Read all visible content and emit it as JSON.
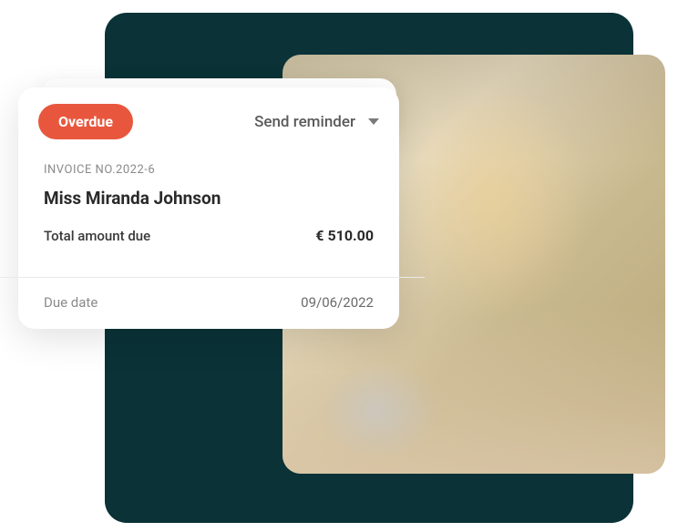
{
  "invoice": {
    "status_label": "Overdue",
    "action_label": "Send reminder",
    "invoice_no_label": "INVOICE NO.2022-6",
    "customer_name": "Miss Miranda Johnson",
    "total_label": "Total amount due",
    "total_value": "€ 510.00",
    "due_date_label": "Due date",
    "due_date_value": "09/06/2022"
  },
  "colors": {
    "badge_bg": "#e8573d",
    "dark_bg": "#0a3237"
  }
}
